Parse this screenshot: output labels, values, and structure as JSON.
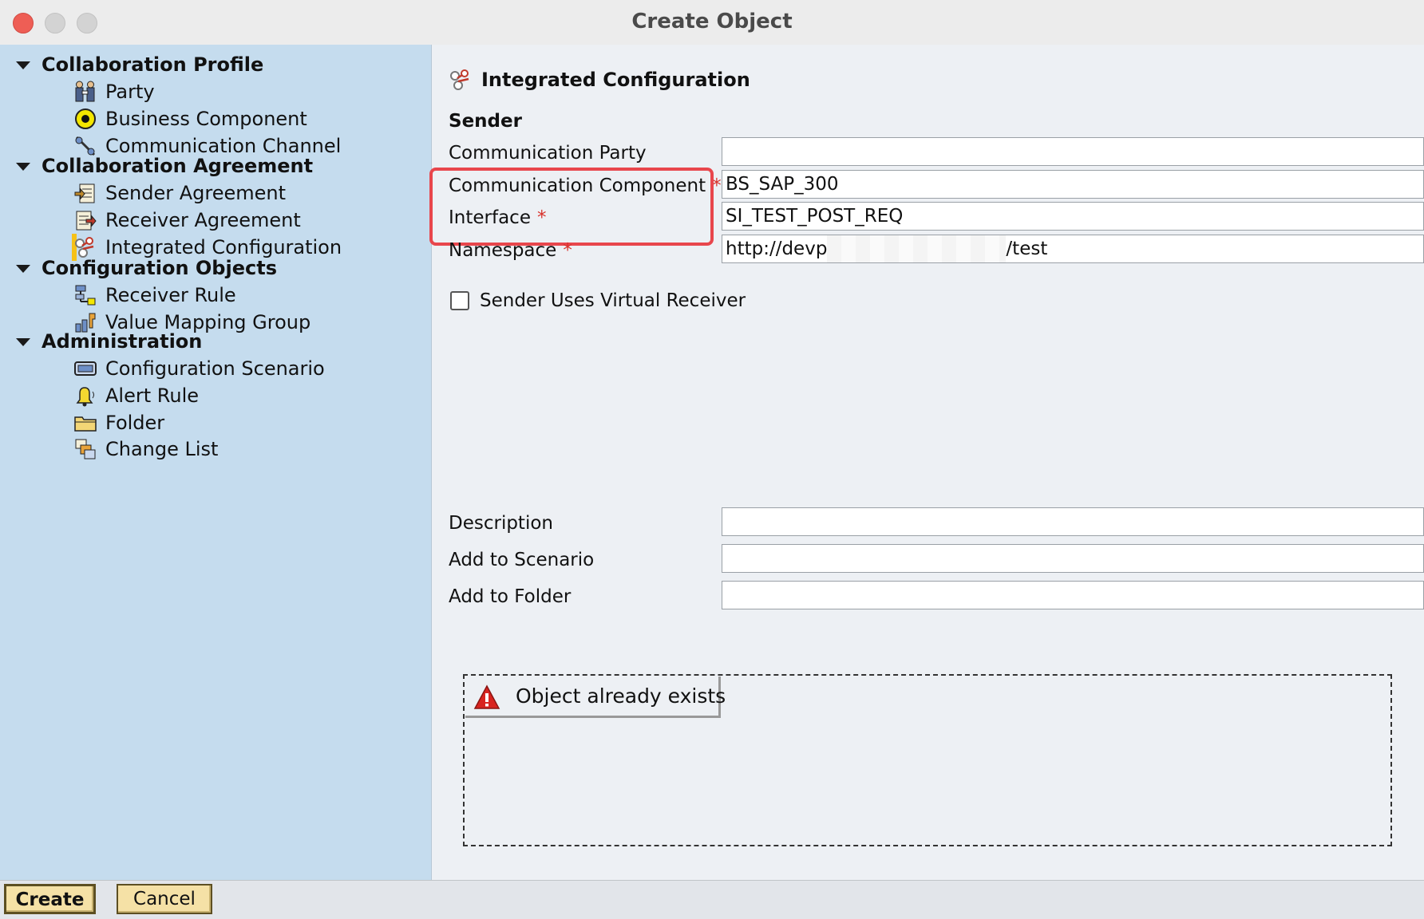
{
  "window": {
    "title": "Create Object"
  },
  "sidebar": {
    "groups": [
      {
        "label": "Collaboration Profile",
        "items": [
          {
            "label": "Party",
            "icon": "party-icon"
          },
          {
            "label": "Business Component",
            "icon": "business-component-icon"
          },
          {
            "label": "Communication Channel",
            "icon": "communication-channel-icon"
          }
        ]
      },
      {
        "label": "Collaboration Agreement",
        "items": [
          {
            "label": "Sender Agreement",
            "icon": "sender-agreement-icon"
          },
          {
            "label": "Receiver Agreement",
            "icon": "receiver-agreement-icon"
          },
          {
            "label": "Integrated Configuration",
            "icon": "integrated-configuration-icon",
            "selected": true
          }
        ]
      },
      {
        "label": "Configuration Objects",
        "items": [
          {
            "label": "Receiver Rule",
            "icon": "receiver-rule-icon"
          },
          {
            "label": "Value Mapping Group",
            "icon": "value-mapping-group-icon"
          }
        ]
      },
      {
        "label": "Administration",
        "items": [
          {
            "label": "Configuration Scenario",
            "icon": "configuration-scenario-icon"
          },
          {
            "label": "Alert Rule",
            "icon": "alert-rule-icon"
          },
          {
            "label": "Folder",
            "icon": "folder-icon"
          },
          {
            "label": "Change List",
            "icon": "change-list-icon"
          }
        ]
      }
    ],
    "selected_color": "#f6c117"
  },
  "form": {
    "heading": "Integrated Configuration",
    "section": "Sender",
    "required_marker": "*",
    "fields": {
      "communication_party": {
        "label": "Communication Party",
        "value": ""
      },
      "communication_component": {
        "label": "Communication Component",
        "value": "BS_SAP_300"
      },
      "interface": {
        "label": "Interface",
        "value": "SI_TEST_POST_REQ"
      },
      "namespace": {
        "label": "Namespace",
        "value_prefix": "http://devp",
        "value_suffix": "/test"
      },
      "description": {
        "label": "Description",
        "value": ""
      },
      "add_to_scenario": {
        "label": "Add to Scenario",
        "value": ""
      },
      "add_to_folder": {
        "label": "Add to Folder",
        "value": ""
      }
    },
    "checkbox": {
      "label": "Sender Uses Virtual Receiver",
      "checked": false
    },
    "highlight_color": "#e8464c"
  },
  "message": {
    "text": "Object already exists",
    "icon": "warning-icon"
  },
  "buttons": {
    "create": "Create",
    "cancel": "Cancel"
  }
}
